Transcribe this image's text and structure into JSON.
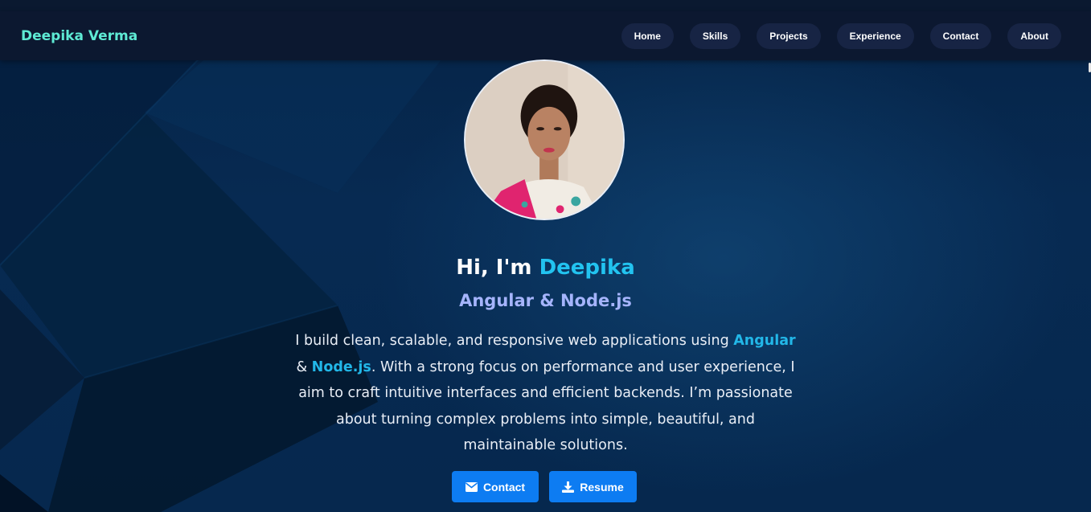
{
  "brand": {
    "name": "Deepika Verma"
  },
  "nav": {
    "items": [
      "Home",
      "Skills",
      "Projects",
      "Experience",
      "Contact",
      "About"
    ]
  },
  "hero": {
    "greeting_prefix": "Hi, I'm ",
    "greeting_name": "Deepika",
    "role": "Angular & Node.js",
    "bio": {
      "part1": "I build clean, scalable, and responsive web applications using ",
      "tech1": "Angular",
      "amp": " & ",
      "tech2": "Node.js",
      "part2": ". With a strong focus on performance and user experience, I aim to craft intuitive interfaces and efficient backends. I’m passionate about turning complex problems into simple, beautiful, and maintainable solutions."
    },
    "avatar": {
      "icon": "profile-photo"
    },
    "buttons": {
      "contact": {
        "label": "Contact",
        "icon": "envelope-icon"
      },
      "resume": {
        "label": "Resume",
        "icon": "download-icon"
      }
    }
  },
  "colors": {
    "brand": "#5eead4",
    "accent": "#22c3f0",
    "role": "#a5b4fc",
    "button": "#0d7cf2",
    "nav_pill": "#172444",
    "navbar": "#0c1830"
  }
}
